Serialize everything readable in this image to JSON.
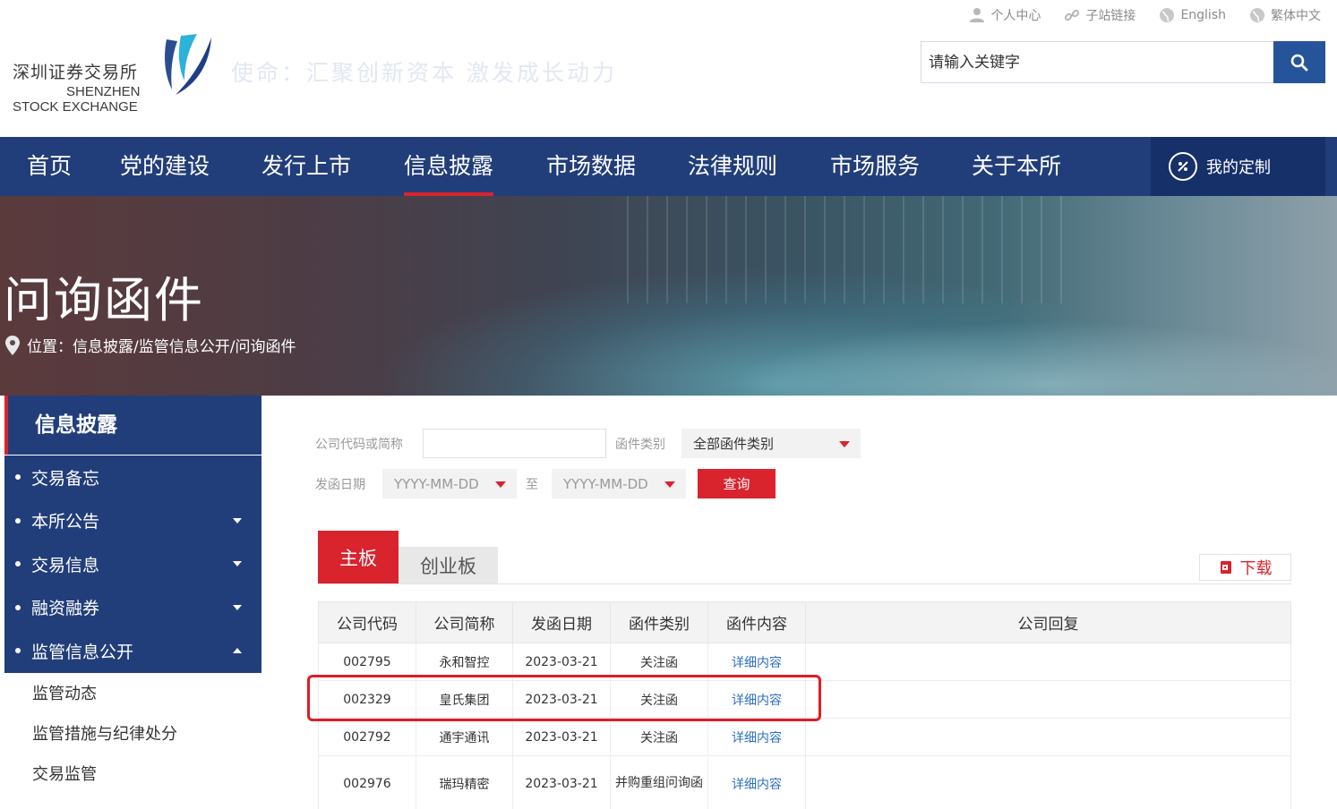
{
  "top_links": [
    {
      "label": "个人中心",
      "icon": "user-icon"
    },
    {
      "label": "子站链接",
      "icon": "link-icon"
    },
    {
      "label": "English",
      "icon": "globe-icon"
    },
    {
      "label": "繁体中文",
      "icon": "globe-icon"
    }
  ],
  "logo": {
    "cn": "深圳证券交易所",
    "en_line1": "SHENZHEN",
    "en_line2": "STOCK EXCHANGE"
  },
  "slogan": "使命：汇聚创新资本 激发成长动力",
  "search": {
    "placeholder": "请输入关键字"
  },
  "nav": {
    "items": [
      "首页",
      "党的建设",
      "发行上市",
      "信息披露",
      "市场数据",
      "法律规则",
      "市场服务",
      "关于本所"
    ],
    "active": "信息披露",
    "custom_label": "我的定制"
  },
  "banner": {
    "title": "问询函件",
    "breadcrumb": "位置：信息披露/监管信息公开/问询函件"
  },
  "sidebar": {
    "title": "信息披露",
    "items": [
      "交易备忘",
      "本所公告",
      "交易信息",
      "融资融券",
      "监管信息公开"
    ],
    "subitems": [
      "监管动态",
      "监管措施与纪律处分",
      "交易监管"
    ]
  },
  "filters": {
    "company_label": "公司代码或简称",
    "type_label": "函件类别",
    "type_value": "全部函件类别",
    "date_label": "发函日期",
    "date_placeholder": "YYYY-MM-DD",
    "to_label": "至",
    "query_label": "查询"
  },
  "tabs": [
    "主板",
    "创业板"
  ],
  "download_label": "下载",
  "colors": {
    "nav": "#223e7a",
    "accent": "#d9232d",
    "link": "#2d6fc1"
  },
  "table": {
    "headers": [
      "公司代码",
      "公司简称",
      "发函日期",
      "函件类别",
      "函件内容",
      "公司回复"
    ],
    "rows": [
      [
        "002795",
        "永和智控",
        "2023-03-21",
        "关注函",
        "详细内容",
        ""
      ],
      [
        "002329",
        "皇氏集团",
        "2023-03-21",
        "关注函",
        "详细内容",
        ""
      ],
      [
        "002792",
        "通宇通讯",
        "2023-03-21",
        "关注函",
        "详细内容",
        ""
      ],
      [
        "002976",
        "瑞玛精密",
        "2023-03-21",
        "并购重组问询函",
        "详细内容",
        ""
      ]
    ]
  }
}
